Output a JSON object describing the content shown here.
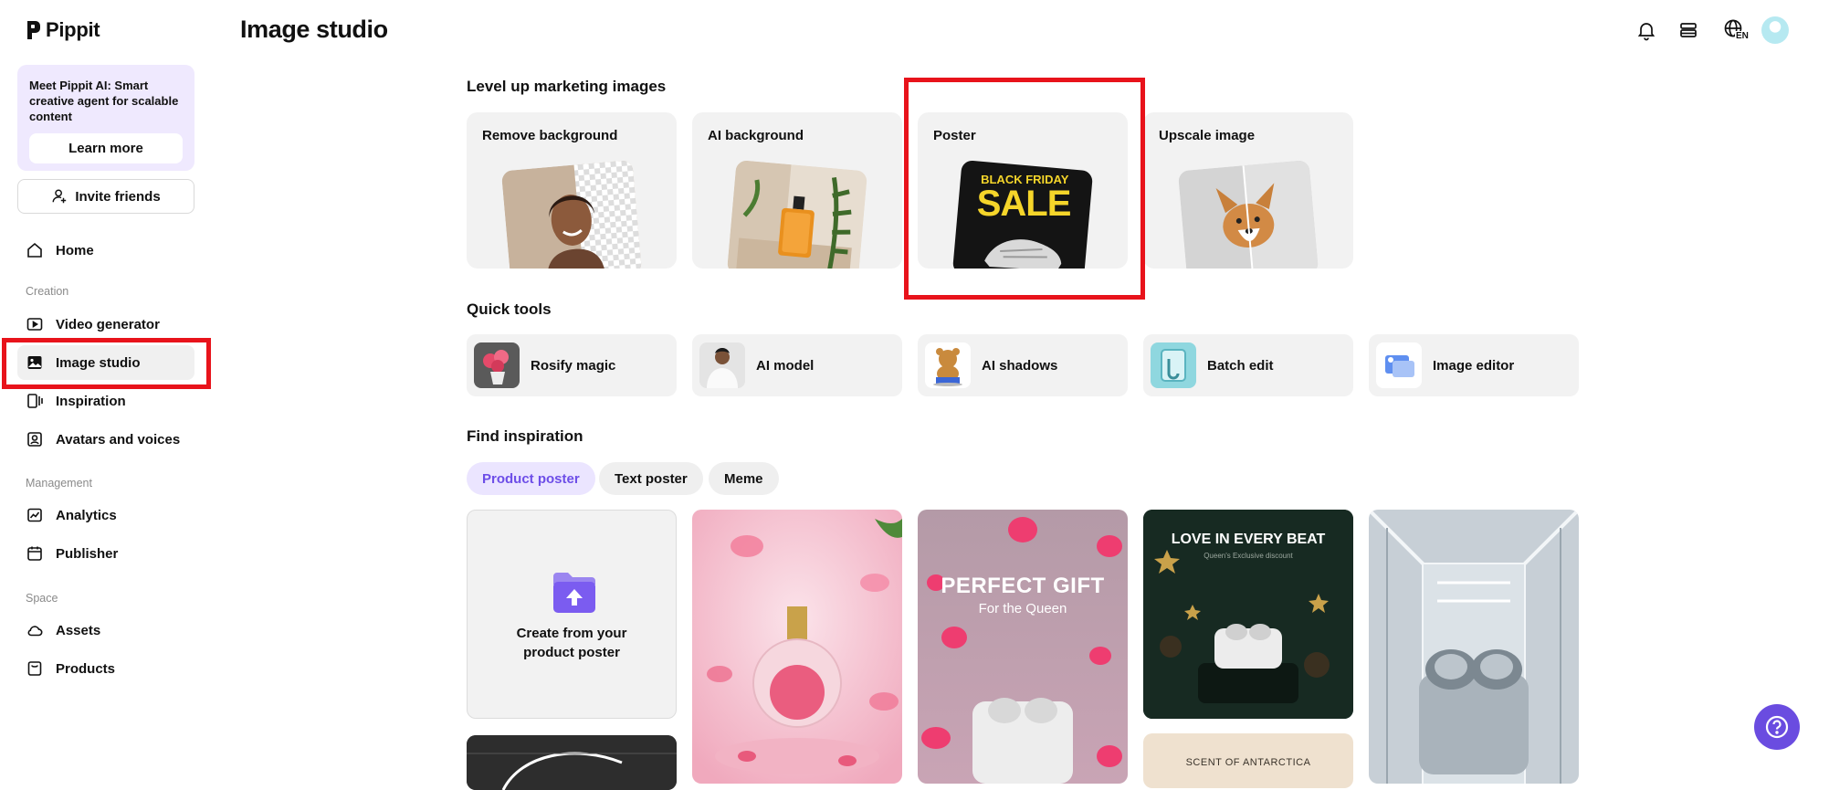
{
  "app": {
    "name": "Pippit"
  },
  "promo": {
    "text": "Meet Pippit AI: Smart creative agent for scalable content",
    "button": "Learn more"
  },
  "invite": {
    "label": "Invite friends"
  },
  "nav": {
    "home": "Home",
    "section_creation": "Creation",
    "video_generator": "Video generator",
    "image_studio": "Image studio",
    "inspiration": "Inspiration",
    "avatars": "Avatars and voices",
    "section_management": "Management",
    "analytics": "Analytics",
    "publisher": "Publisher",
    "section_space": "Space",
    "assets": "Assets",
    "products": "Products"
  },
  "header": {
    "title": "Image studio",
    "language_badge": "EN"
  },
  "level_up": {
    "title": "Level up marketing images",
    "cards": [
      "Remove background",
      "AI background",
      "Poster",
      "Upscale image"
    ],
    "poster_text": {
      "line1": "BLACK FRIDAY",
      "line2": "SALE"
    }
  },
  "quick_tools": {
    "title": "Quick tools",
    "items": [
      "Rosify magic",
      "AI model",
      "AI shadows",
      "Batch edit",
      "Image editor"
    ]
  },
  "inspiration": {
    "title": "Find inspiration",
    "chips": [
      "Product poster",
      "Text poster",
      "Meme"
    ],
    "active_chip": "Product poster",
    "create_card": "Create from your product poster",
    "poster_gift": {
      "title": "PERFECT GIFT",
      "subtitle": "For the Queen"
    },
    "poster_love": {
      "title": "LOVE IN EVERY BEAT",
      "subtitle": "Queen's Exclusive discount"
    },
    "poster_scent": "SCENT OF ANTARCTICA"
  },
  "colors": {
    "accent": "#6a4ce0",
    "highlight": "#e8131b",
    "promo_bg": "#efe9fe"
  }
}
